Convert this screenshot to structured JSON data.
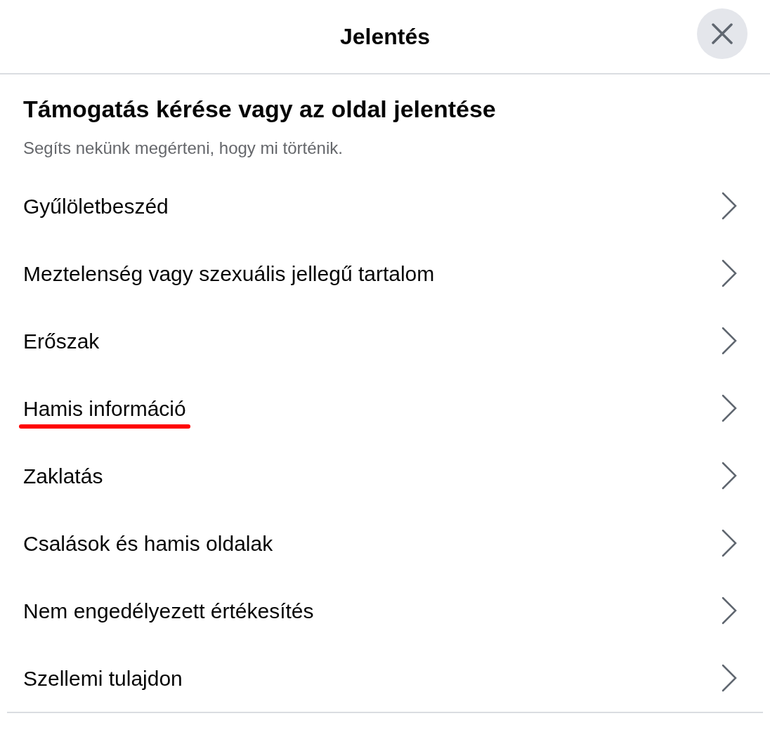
{
  "dialog": {
    "title": "Jelentés"
  },
  "heading": "Támogatás kérése vagy az oldal jelentése",
  "subtitle": "Segíts nekünk megérteni, hogy mi történik.",
  "options": [
    {
      "label": "Gyűlöletbeszéd",
      "underlined": false
    },
    {
      "label": "Meztelenség vagy szexuális jellegű tartalom",
      "underlined": false
    },
    {
      "label": "Erőszak",
      "underlined": false
    },
    {
      "label": "Hamis információ",
      "underlined": true
    },
    {
      "label": "Zaklatás",
      "underlined": false
    },
    {
      "label": "Csalások és hamis oldalak",
      "underlined": false
    },
    {
      "label": "Nem engedélyezett értékesítés",
      "underlined": false
    },
    {
      "label": "Szellemi tulajdon",
      "underlined": false
    }
  ]
}
